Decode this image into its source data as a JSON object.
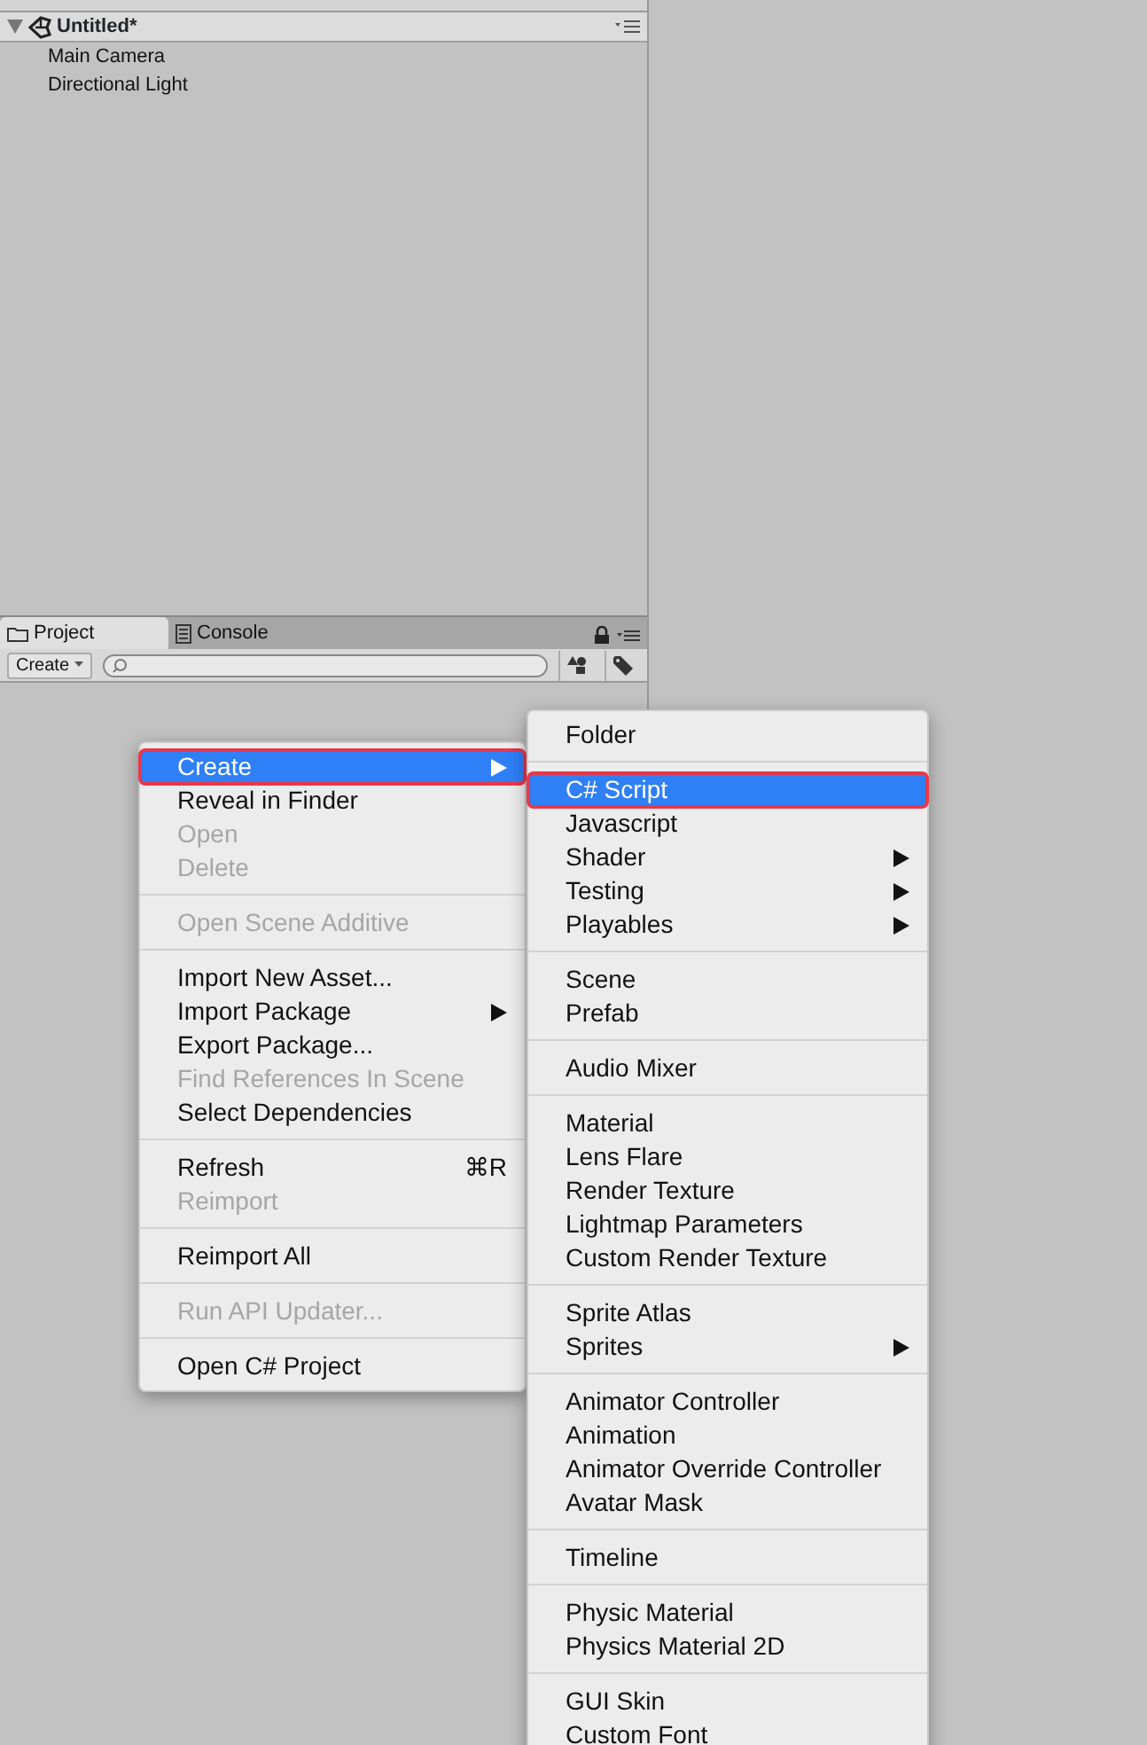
{
  "hierarchy": {
    "scene": "Untitled*",
    "expanded": true,
    "items": [
      "Main Camera",
      "Directional Light"
    ]
  },
  "project": {
    "tabs": [
      {
        "label": "Project",
        "kind": "folder",
        "selected": true
      },
      {
        "label": "Console",
        "kind": "console",
        "selected": false
      }
    ],
    "create_button": "Create"
  },
  "context_menu": {
    "groups": [
      [
        {
          "label": "Create",
          "submenu": true,
          "disabled": false,
          "selected": true,
          "annotated": true
        },
        {
          "label": "Reveal in Finder",
          "disabled": false,
          "selected": false,
          "annotated": false
        },
        {
          "label": "Open",
          "disabled": true,
          "selected": false,
          "annotated": false
        },
        {
          "label": "Delete",
          "disabled": true,
          "selected": false,
          "annotated": false
        }
      ],
      [
        {
          "label": "Open Scene Additive",
          "disabled": true,
          "selected": false,
          "annotated": false
        }
      ],
      [
        {
          "label": "Import New Asset...",
          "disabled": false,
          "selected": false,
          "annotated": false
        },
        {
          "label": "Import Package",
          "submenu": true,
          "disabled": false,
          "selected": false,
          "annotated": false
        },
        {
          "label": "Export Package...",
          "disabled": false,
          "selected": false,
          "annotated": false
        },
        {
          "label": "Find References In Scene",
          "disabled": true,
          "selected": false,
          "annotated": false
        },
        {
          "label": "Select Dependencies",
          "disabled": false,
          "selected": false,
          "annotated": false
        }
      ],
      [
        {
          "label": "Refresh",
          "shortcut": "⌘R",
          "disabled": false,
          "selected": false,
          "annotated": false
        },
        {
          "label": "Reimport",
          "disabled": true,
          "selected": false,
          "annotated": false
        }
      ],
      [
        {
          "label": "Reimport All",
          "disabled": false,
          "selected": false,
          "annotated": false
        }
      ],
      [
        {
          "label": "Run API Updater...",
          "disabled": true,
          "selected": false,
          "annotated": false
        }
      ],
      [
        {
          "label": "Open C# Project",
          "disabled": false,
          "selected": false,
          "annotated": false
        }
      ]
    ]
  },
  "submenu": {
    "groups": [
      [
        {
          "label": "Folder",
          "selected": false,
          "annotated": false
        }
      ],
      [
        {
          "label": "C# Script",
          "selected": true,
          "annotated": true
        },
        {
          "label": "Javascript",
          "selected": false,
          "annotated": false
        },
        {
          "label": "Shader",
          "submenu": true,
          "selected": false,
          "annotated": false
        },
        {
          "label": "Testing",
          "submenu": true,
          "selected": false,
          "annotated": false
        },
        {
          "label": "Playables",
          "submenu": true,
          "selected": false,
          "annotated": false
        }
      ],
      [
        {
          "label": "Scene",
          "selected": false,
          "annotated": false
        },
        {
          "label": "Prefab",
          "selected": false,
          "annotated": false
        }
      ],
      [
        {
          "label": "Audio Mixer",
          "selected": false,
          "annotated": false
        }
      ],
      [
        {
          "label": "Material",
          "selected": false,
          "annotated": false
        },
        {
          "label": "Lens Flare",
          "selected": false,
          "annotated": false
        },
        {
          "label": "Render Texture",
          "selected": false,
          "annotated": false
        },
        {
          "label": "Lightmap Parameters",
          "selected": false,
          "annotated": false
        },
        {
          "label": "Custom Render Texture",
          "selected": false,
          "annotated": false
        }
      ],
      [
        {
          "label": "Sprite Atlas",
          "selected": false,
          "annotated": false
        },
        {
          "label": "Sprites",
          "submenu": true,
          "selected": false,
          "annotated": false
        }
      ],
      [
        {
          "label": "Animator Controller",
          "selected": false,
          "annotated": false
        },
        {
          "label": "Animation",
          "selected": false,
          "annotated": false
        },
        {
          "label": "Animator Override Controller",
          "selected": false,
          "annotated": false
        },
        {
          "label": "Avatar Mask",
          "selected": false,
          "annotated": false
        }
      ],
      [
        {
          "label": "Timeline",
          "selected": false,
          "annotated": false
        }
      ],
      [
        {
          "label": "Physic Material",
          "selected": false,
          "annotated": false
        },
        {
          "label": "Physics Material 2D",
          "selected": false,
          "annotated": false
        }
      ],
      [
        {
          "label": "GUI Skin",
          "selected": false,
          "annotated": false
        },
        {
          "label": "Custom Font",
          "selected": false,
          "annotated": false
        }
      ]
    ]
  }
}
